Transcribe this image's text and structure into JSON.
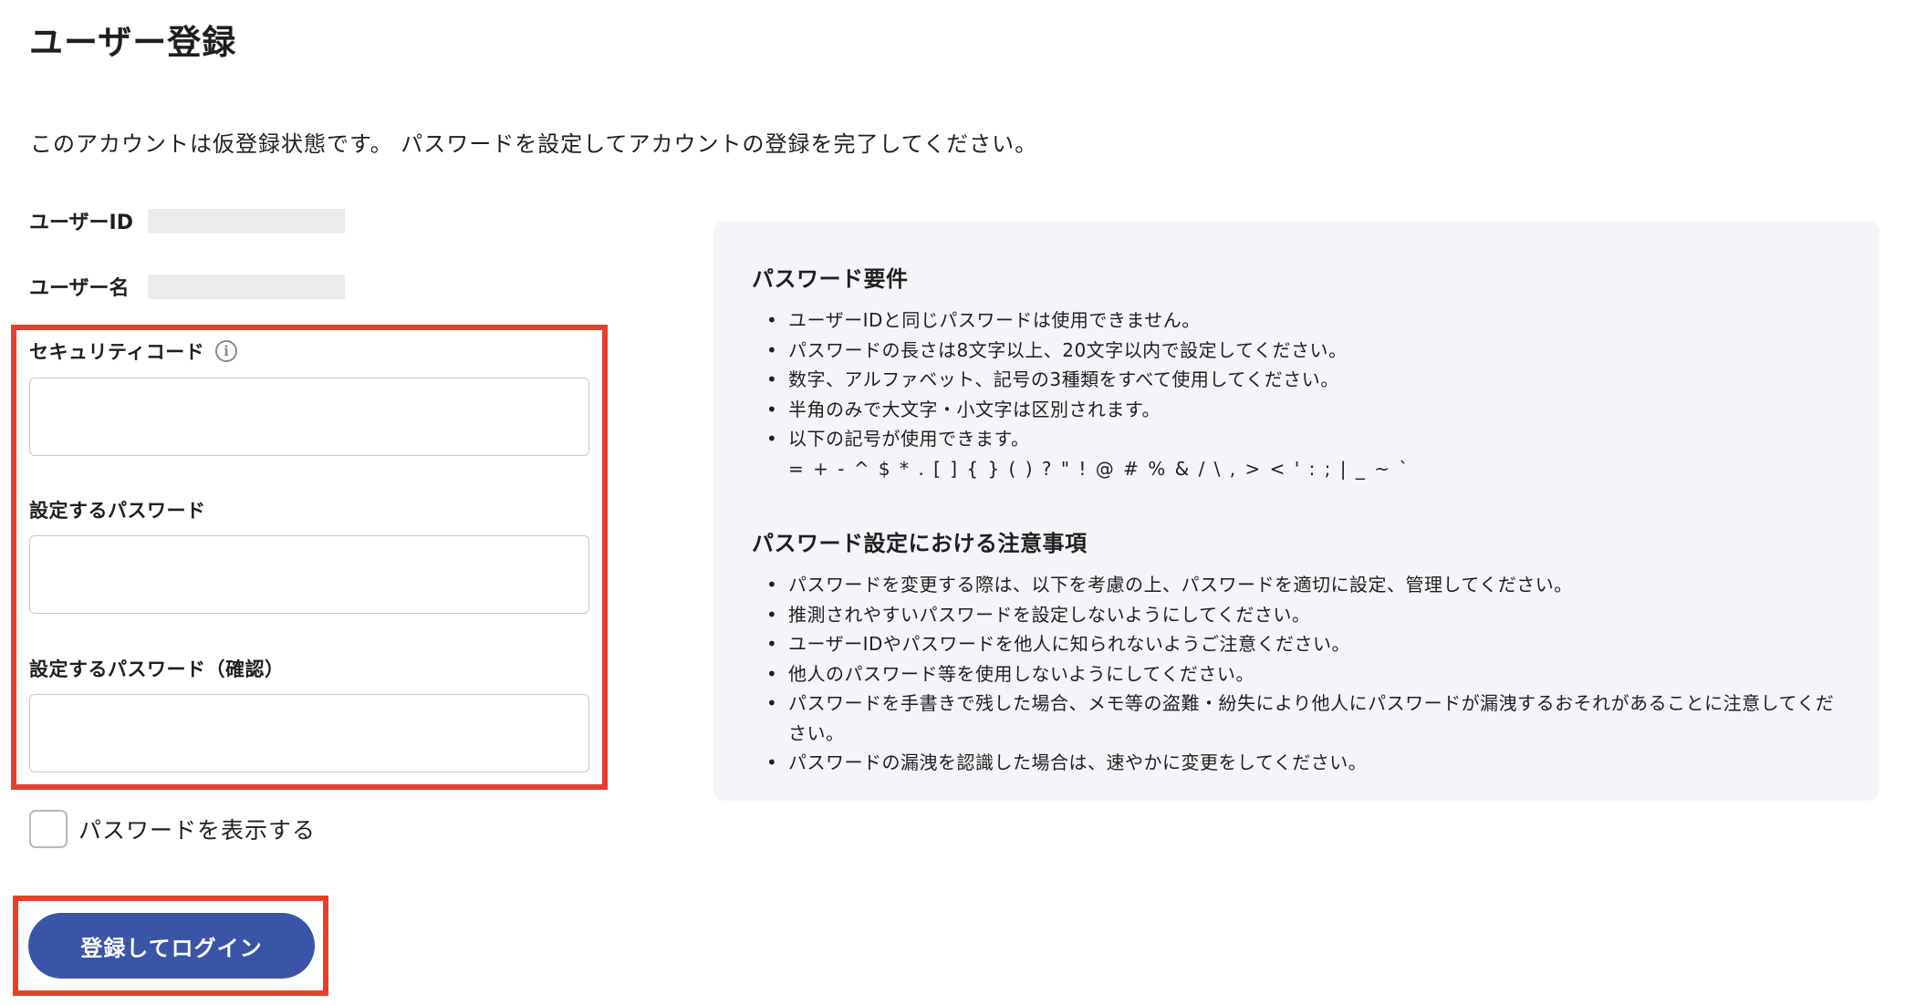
{
  "page": {
    "title": "ユーザー登録",
    "intro": "このアカウントは仮登録状態です。 パスワードを設定してアカウントの登録を完了してください。"
  },
  "account": {
    "user_id_label": "ユーザーID",
    "user_id_value": "",
    "user_name_label": "ユーザー名",
    "user_name_value": ""
  },
  "form": {
    "security_code_label": "セキュリティコード",
    "security_code_value": "",
    "password_label": "設定するパスワード",
    "password_value": "",
    "password_confirm_label": "設定するパスワード（確認）",
    "password_confirm_value": "",
    "show_password_label": "パスワードを表示する",
    "show_password_checked": false,
    "submit_label": "登録してログイン"
  },
  "requirements": {
    "heading": "パスワード要件",
    "items": [
      "ユーザーIDと同じパスワードは使用できません。",
      "パスワードの長さは8文字以上、20文字以内で設定してください。",
      "数字、アルファベット、記号の3種類をすべて使用してください。",
      "半角のみで大文字・小文字は区別されます。",
      "以下の記号が使用できます。"
    ],
    "symbols": "= + - ^ $ * . [ ] { } ( ) ? \" ! @ # % & / \\ , > < ' : ; | _ ~ `"
  },
  "precautions": {
    "heading": "パスワード設定における注意事項",
    "items": [
      "パスワードを変更する際は、以下を考慮の上、パスワードを適切に設定、管理してください。",
      "推測されやすいパスワードを設定しないようにしてください。",
      "ユーザーIDやパスワードを他人に知られないようご注意ください。",
      "他人のパスワード等を使用しないようにしてください。",
      "パスワードを手書きで残した場合、メモ等の盗難・紛失により他人にパスワードが漏洩するおそれがあることに注意してください。",
      "パスワードの漏洩を認識した場合は、速やかに変更をしてください。"
    ]
  },
  "icons": {
    "info": "info-icon"
  },
  "colors": {
    "highlight": "#e4402d",
    "primary_button": "#3a55a8",
    "panel_background": "#f3f5f8"
  }
}
